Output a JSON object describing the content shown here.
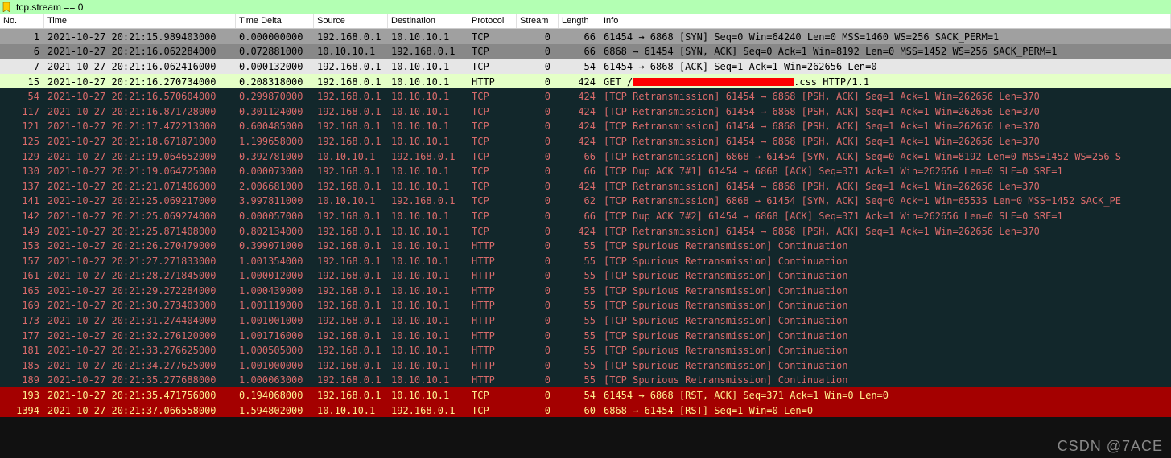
{
  "filter": {
    "text": "tcp.stream == 0"
  },
  "columns": {
    "no": "No.",
    "time": "Time",
    "delta": "Time Delta",
    "src": "Source",
    "dst": "Destination",
    "proto": "Protocol",
    "stream": "Stream",
    "len": "Length",
    "info": "Info"
  },
  "watermark": "CSDN @7ACE",
  "packets": [
    {
      "no": "1",
      "time": "2021-10-27 20:21:15.989403000",
      "delta": "0.000000000",
      "src": "192.168.0.1",
      "dst": "10.10.10.1",
      "proto": "TCP",
      "stream": "0",
      "len": "66",
      "info": "61454 → 6868 [SYN] Seq=0 Win=64240 Len=0 MSS=1460 WS=256 SACK_PERM=1",
      "theme": "t-syn"
    },
    {
      "no": "6",
      "time": "2021-10-27 20:21:16.062284000",
      "delta": "0.072881000",
      "src": "10.10.10.1",
      "dst": "192.168.0.1",
      "proto": "TCP",
      "stream": "0",
      "len": "66",
      "info": "6868 → 61454 [SYN, ACK] Seq=0 Ack=1 Win=8192 Len=0 MSS=1452 WS=256 SACK_PERM=1",
      "theme": "t-syn2"
    },
    {
      "no": "7",
      "time": "2021-10-27 20:21:16.062416000",
      "delta": "0.000132000",
      "src": "192.168.0.1",
      "dst": "10.10.10.1",
      "proto": "TCP",
      "stream": "0",
      "len": "54",
      "info": "61454 → 6868 [ACK] Seq=1 Ack=1 Win=262656 Len=0",
      "theme": "t-ack"
    },
    {
      "no": "15",
      "time": "2021-10-27 20:21:16.270734000",
      "delta": "0.208318000",
      "src": "192.168.0.1",
      "dst": "10.10.10.1",
      "proto": "HTTP",
      "stream": "0",
      "len": "424",
      "info": "GET /",
      "redact": true,
      "info_after": ".css HTTP/1.1",
      "theme": "t-http"
    },
    {
      "no": "54",
      "time": "2021-10-27 20:21:16.570604000",
      "delta": "0.299870000",
      "src": "192.168.0.1",
      "dst": "10.10.10.1",
      "proto": "TCP",
      "stream": "0",
      "len": "424",
      "info": "[TCP Retransmission] 61454 → 6868 [PSH, ACK] Seq=1 Ack=1 Win=262656 Len=370",
      "theme": "t-retrans"
    },
    {
      "no": "117",
      "time": "2021-10-27 20:21:16.871728000",
      "delta": "0.301124000",
      "src": "192.168.0.1",
      "dst": "10.10.10.1",
      "proto": "TCP",
      "stream": "0",
      "len": "424",
      "info": "[TCP Retransmission] 61454 → 6868 [PSH, ACK] Seq=1 Ack=1 Win=262656 Len=370",
      "theme": "t-retrans"
    },
    {
      "no": "121",
      "time": "2021-10-27 20:21:17.472213000",
      "delta": "0.600485000",
      "src": "192.168.0.1",
      "dst": "10.10.10.1",
      "proto": "TCP",
      "stream": "0",
      "len": "424",
      "info": "[TCP Retransmission] 61454 → 6868 [PSH, ACK] Seq=1 Ack=1 Win=262656 Len=370",
      "theme": "t-retrans"
    },
    {
      "no": "125",
      "time": "2021-10-27 20:21:18.671871000",
      "delta": "1.199658000",
      "src": "192.168.0.1",
      "dst": "10.10.10.1",
      "proto": "TCP",
      "stream": "0",
      "len": "424",
      "info": "[TCP Retransmission] 61454 → 6868 [PSH, ACK] Seq=1 Ack=1 Win=262656 Len=370",
      "theme": "t-retrans"
    },
    {
      "no": "129",
      "time": "2021-10-27 20:21:19.064652000",
      "delta": "0.392781000",
      "src": "10.10.10.1",
      "dst": "192.168.0.1",
      "proto": "TCP",
      "stream": "0",
      "len": "66",
      "info": "[TCP Retransmission] 6868 → 61454 [SYN, ACK] Seq=0 Ack=1 Win=8192 Len=0 MSS=1452 WS=256 S",
      "theme": "t-retrans"
    },
    {
      "no": "130",
      "time": "2021-10-27 20:21:19.064725000",
      "delta": "0.000073000",
      "src": "192.168.0.1",
      "dst": "10.10.10.1",
      "proto": "TCP",
      "stream": "0",
      "len": "66",
      "info": "[TCP Dup ACK 7#1] 61454 → 6868 [ACK] Seq=371 Ack=1 Win=262656 Len=0 SLE=0 SRE=1",
      "theme": "t-retrans"
    },
    {
      "no": "137",
      "time": "2021-10-27 20:21:21.071406000",
      "delta": "2.006681000",
      "src": "192.168.0.1",
      "dst": "10.10.10.1",
      "proto": "TCP",
      "stream": "0",
      "len": "424",
      "info": "[TCP Retransmission] 61454 → 6868 [PSH, ACK] Seq=1 Ack=1 Win=262656 Len=370",
      "theme": "t-retrans"
    },
    {
      "no": "141",
      "time": "2021-10-27 20:21:25.069217000",
      "delta": "3.997811000",
      "src": "10.10.10.1",
      "dst": "192.168.0.1",
      "proto": "TCP",
      "stream": "0",
      "len": "62",
      "info": "[TCP Retransmission] 6868 → 61454 [SYN, ACK] Seq=0 Ack=1 Win=65535 Len=0 MSS=1452 SACK_PE",
      "theme": "t-retrans"
    },
    {
      "no": "142",
      "time": "2021-10-27 20:21:25.069274000",
      "delta": "0.000057000",
      "src": "192.168.0.1",
      "dst": "10.10.10.1",
      "proto": "TCP",
      "stream": "0",
      "len": "66",
      "info": "[TCP Dup ACK 7#2] 61454 → 6868 [ACK] Seq=371 Ack=1 Win=262656 Len=0 SLE=0 SRE=1",
      "theme": "t-retrans"
    },
    {
      "no": "149",
      "time": "2021-10-27 20:21:25.871408000",
      "delta": "0.802134000",
      "src": "192.168.0.1",
      "dst": "10.10.10.1",
      "proto": "TCP",
      "stream": "0",
      "len": "424",
      "info": "[TCP Retransmission] 61454 → 6868 [PSH, ACK] Seq=1 Ack=1 Win=262656 Len=370",
      "theme": "t-retrans"
    },
    {
      "no": "153",
      "time": "2021-10-27 20:21:26.270479000",
      "delta": "0.399071000",
      "src": "192.168.0.1",
      "dst": "10.10.10.1",
      "proto": "HTTP",
      "stream": "0",
      "len": "55",
      "info": "[TCP Spurious Retransmission] Continuation",
      "theme": "t-retrans"
    },
    {
      "no": "157",
      "time": "2021-10-27 20:21:27.271833000",
      "delta": "1.001354000",
      "src": "192.168.0.1",
      "dst": "10.10.10.1",
      "proto": "HTTP",
      "stream": "0",
      "len": "55",
      "info": "[TCP Spurious Retransmission] Continuation",
      "theme": "t-retrans"
    },
    {
      "no": "161",
      "time": "2021-10-27 20:21:28.271845000",
      "delta": "1.000012000",
      "src": "192.168.0.1",
      "dst": "10.10.10.1",
      "proto": "HTTP",
      "stream": "0",
      "len": "55",
      "info": "[TCP Spurious Retransmission] Continuation",
      "theme": "t-retrans"
    },
    {
      "no": "165",
      "time": "2021-10-27 20:21:29.272284000",
      "delta": "1.000439000",
      "src": "192.168.0.1",
      "dst": "10.10.10.1",
      "proto": "HTTP",
      "stream": "0",
      "len": "55",
      "info": "[TCP Spurious Retransmission] Continuation",
      "theme": "t-retrans"
    },
    {
      "no": "169",
      "time": "2021-10-27 20:21:30.273403000",
      "delta": "1.001119000",
      "src": "192.168.0.1",
      "dst": "10.10.10.1",
      "proto": "HTTP",
      "stream": "0",
      "len": "55",
      "info": "[TCP Spurious Retransmission] Continuation",
      "theme": "t-retrans"
    },
    {
      "no": "173",
      "time": "2021-10-27 20:21:31.274404000",
      "delta": "1.001001000",
      "src": "192.168.0.1",
      "dst": "10.10.10.1",
      "proto": "HTTP",
      "stream": "0",
      "len": "55",
      "info": "[TCP Spurious Retransmission] Continuation",
      "theme": "t-retrans"
    },
    {
      "no": "177",
      "time": "2021-10-27 20:21:32.276120000",
      "delta": "1.001716000",
      "src": "192.168.0.1",
      "dst": "10.10.10.1",
      "proto": "HTTP",
      "stream": "0",
      "len": "55",
      "info": "[TCP Spurious Retransmission] Continuation",
      "theme": "t-retrans"
    },
    {
      "no": "181",
      "time": "2021-10-27 20:21:33.276625000",
      "delta": "1.000505000",
      "src": "192.168.0.1",
      "dst": "10.10.10.1",
      "proto": "HTTP",
      "stream": "0",
      "len": "55",
      "info": "[TCP Spurious Retransmission] Continuation",
      "theme": "t-retrans"
    },
    {
      "no": "185",
      "time": "2021-10-27 20:21:34.277625000",
      "delta": "1.001000000",
      "src": "192.168.0.1",
      "dst": "10.10.10.1",
      "proto": "HTTP",
      "stream": "0",
      "len": "55",
      "info": "[TCP Spurious Retransmission] Continuation",
      "theme": "t-retrans"
    },
    {
      "no": "189",
      "time": "2021-10-27 20:21:35.277688000",
      "delta": "1.000063000",
      "src": "192.168.0.1",
      "dst": "10.10.10.1",
      "proto": "HTTP",
      "stream": "0",
      "len": "55",
      "info": "[TCP Spurious Retransmission] Continuation",
      "theme": "t-retrans"
    },
    {
      "no": "193",
      "time": "2021-10-27 20:21:35.471756000",
      "delta": "0.194068000",
      "src": "192.168.0.1",
      "dst": "10.10.10.1",
      "proto": "TCP",
      "stream": "0",
      "len": "54",
      "info": "61454 → 6868 [RST, ACK] Seq=371 Ack=1 Win=0 Len=0",
      "theme": "t-rst"
    },
    {
      "no": "1394",
      "time": "2021-10-27 20:21:37.066558000",
      "delta": "1.594802000",
      "src": "10.10.10.1",
      "dst": "192.168.0.1",
      "proto": "TCP",
      "stream": "0",
      "len": "60",
      "info": "6868 → 61454 [RST] Seq=1 Win=0 Len=0",
      "theme": "t-rst"
    }
  ]
}
